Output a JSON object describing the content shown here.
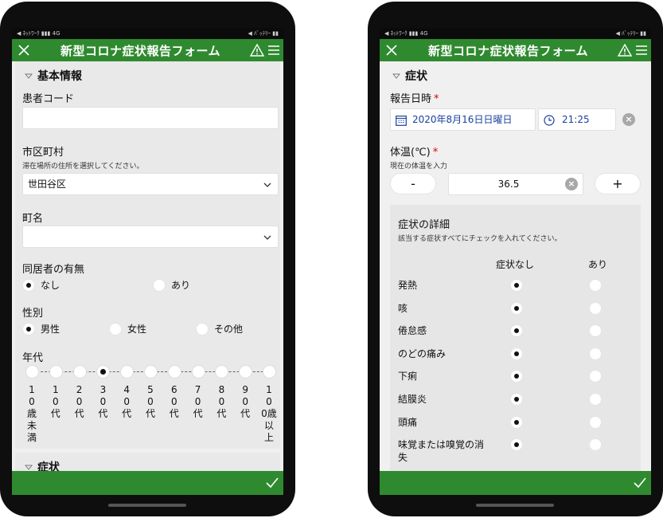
{
  "status_bar": {
    "left": "◀ ﾈｯﾄﾜｰｸ ▮▮▮ 4G",
    "right": "◀ ﾊﾞｯﾃﾘｰ ▮▮"
  },
  "app": {
    "title": "新型コロナ症状報告フォーム"
  },
  "left": {
    "section_title": "基本情報",
    "patient_code": {
      "label": "患者コード",
      "value": ""
    },
    "city": {
      "label": "市区町村",
      "sub": "滞在場所の住所を選択してください。",
      "value": "世田谷区"
    },
    "town": {
      "label": "町名",
      "value": ""
    },
    "cohabitant": {
      "label": "同居者の有無",
      "options": [
        "なし",
        "あり"
      ],
      "selected": 0
    },
    "gender": {
      "label": "性別",
      "options": [
        "男性",
        "女性",
        "その他"
      ],
      "selected": 0
    },
    "age": {
      "label": "年代",
      "stops": [
        [
          "1",
          "0",
          "歳",
          "未",
          "満"
        ],
        [
          "1",
          "0",
          "代"
        ],
        [
          "2",
          "0",
          "代"
        ],
        [
          "3",
          "0",
          "代"
        ],
        [
          "4",
          "0",
          "代"
        ],
        [
          "5",
          "0",
          "代"
        ],
        [
          "6",
          "0",
          "代"
        ],
        [
          "7",
          "0",
          "代"
        ],
        [
          "8",
          "0",
          "代"
        ],
        [
          "9",
          "0",
          "代"
        ],
        [
          "1",
          "0",
          "0歳",
          "以",
          "上"
        ]
      ],
      "selected": 3
    },
    "next_section_title": "症状"
  },
  "right": {
    "section_title": "症状",
    "report_datetime": {
      "label": "報告日時",
      "required": "*",
      "date": "2020年8月16日日曜日",
      "time": "21:25"
    },
    "temperature": {
      "label": "体温(℃)",
      "required": "*",
      "sub": "現在の体温を入力",
      "value": "36.5",
      "minus": "-",
      "plus": "+"
    },
    "symptoms": {
      "title": "症状の詳細",
      "sub": "該当する症状すべてにチェックを入れてください。",
      "col_none": "症状なし",
      "col_yes": "あり",
      "rows": [
        {
          "name": "発熱",
          "none": true
        },
        {
          "name": "咳",
          "none": true
        },
        {
          "name": "倦怠感",
          "none": true
        },
        {
          "name": "のどの痛み",
          "none": true
        },
        {
          "name": "下痢",
          "none": true
        },
        {
          "name": "結膜炎",
          "none": true
        },
        {
          "name": "頭痛",
          "none": true
        },
        {
          "name": "味覚または嗅覚の消失",
          "none": true
        }
      ]
    }
  },
  "colors": {
    "accent": "#2f8a2f",
    "date_text": "#1a3fa0"
  },
  "icons": {
    "close": "close-icon",
    "warning": "warning-icon",
    "menu": "menu-icon",
    "submit": "check-icon",
    "calendar": "calendar-icon",
    "clock": "clock-icon"
  }
}
